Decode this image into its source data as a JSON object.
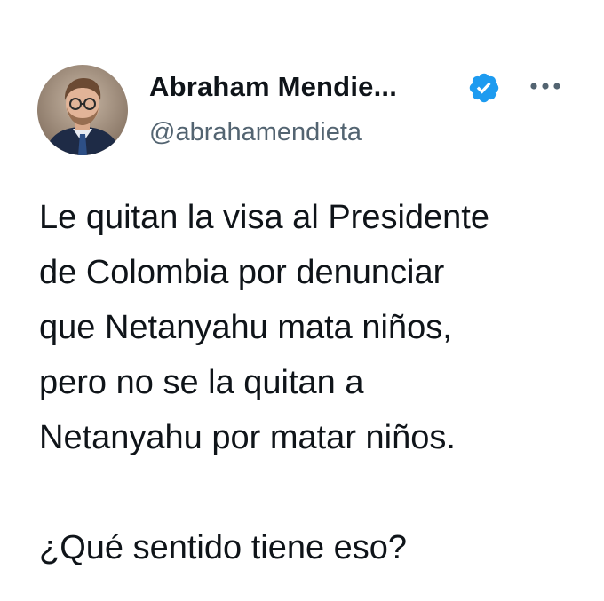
{
  "author": {
    "display_name": "Abraham Mendie...",
    "handle": "@abrahamendieta",
    "verified": true
  },
  "tweet": {
    "lines": [
      "Le quitan la visa al Presidente",
      "de Colombia por denunciar",
      "que Netanyahu mata niños,",
      "pero no se la quitan a",
      "Netanyahu por matar niños."
    ],
    "closing": "¿Qué sentido tiene eso?"
  },
  "icons": {
    "verified": "verified-badge-icon",
    "more": "more-options-icon"
  },
  "colors": {
    "verified_blue": "#1d9bf0",
    "text": "#0f1419",
    "secondary_text": "#536471",
    "background": "#ffffff"
  }
}
